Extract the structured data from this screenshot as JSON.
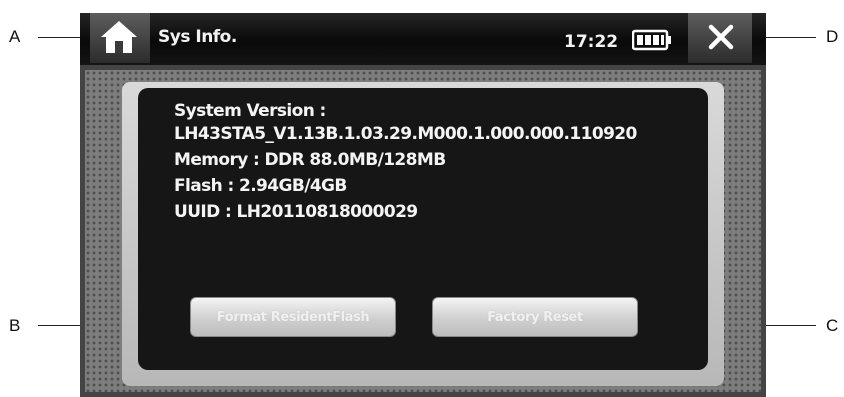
{
  "callouts": {
    "a": "A",
    "b": "B",
    "c": "C",
    "d": "D"
  },
  "header": {
    "title": "Sys Info.",
    "time": "17:22",
    "icons": {
      "home": "home-icon",
      "battery": "battery-icon",
      "close": "close-icon"
    }
  },
  "info": {
    "system_version_label": "System Version :",
    "system_version_value": "LH43STA5_V1.13B.1.03.29.M000.1.000.000.110920",
    "memory": "Memory : DDR 88.0MB/128MB",
    "flash": "Flash :  2.94GB/4GB",
    "uuid": "UUID : LH20110818000029"
  },
  "buttons": {
    "format": "Format ResidentFlash",
    "factory_reset": "Factory Reset"
  },
  "colors": {
    "screen_bg": "#0b0b0b",
    "frame": "#7d7d7d",
    "panel": "#161616",
    "text": "#f4f4f4"
  }
}
